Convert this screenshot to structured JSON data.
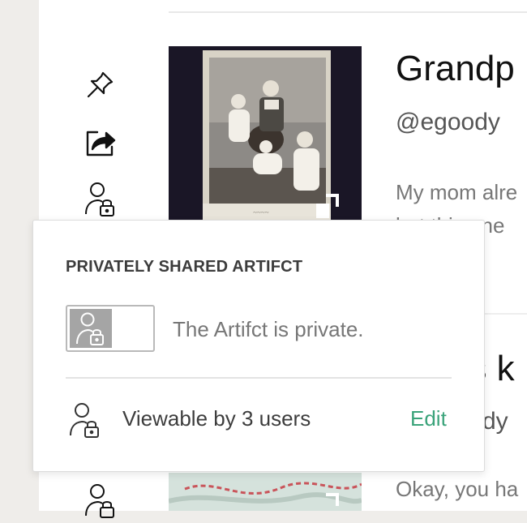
{
  "card1": {
    "title": "Grandp",
    "handle": "@egoody",
    "body_line1": "My mom alre",
    "body_line2": "but this one"
  },
  "card2": {
    "title": "'s k",
    "handle": "dy",
    "body": "Okay, you ha"
  },
  "sidebar_icons": [
    "pin-icon",
    "share-icon",
    "private-user-icon"
  ],
  "popover": {
    "heading": "PRIVATELY SHARED ARTIFCT",
    "privacy_status": "The Artifct is private.",
    "viewers_text": "Viewable by 3 users",
    "edit_label": "Edit"
  },
  "colors": {
    "accent": "#3aa37a",
    "background": "#efedea",
    "toggle_knob": "#a5a5a5"
  }
}
